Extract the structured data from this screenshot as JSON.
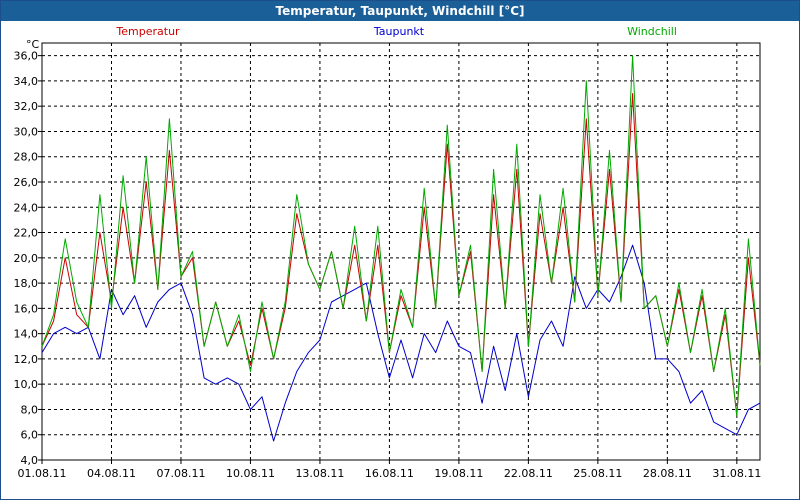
{
  "window": {
    "title": "Temperatur, Taupunkt, Windchill [°C]"
  },
  "chart_data": {
    "type": "line",
    "title": "Temperatur, Taupunkt, Windchill [°C]",
    "ylabel": "°C",
    "xlim": [
      1.0,
      32.0
    ],
    "ylim": [
      4.0,
      37.0
    ],
    "grid": true,
    "legend_position": "top",
    "x_tick_labels": [
      "01.08.11",
      "04.08.11",
      "07.08.11",
      "10.08.11",
      "13.08.11",
      "16.08.11",
      "19.08.11",
      "22.08.11",
      "25.08.11",
      "28.08.11",
      "31.08.11"
    ],
    "x_tick_values": [
      1,
      4,
      7,
      10,
      13,
      16,
      19,
      22,
      25,
      28,
      31
    ],
    "y_tick_labels": [
      "4,0",
      "6,0",
      "8,0",
      "10,0",
      "12,0",
      "14,0",
      "16,0",
      "18,0",
      "20,0",
      "22,0",
      "24,0",
      "26,0",
      "28,0",
      "30,0",
      "32,0",
      "34,0",
      "36,0"
    ],
    "y_tick_values": [
      4,
      6,
      8,
      10,
      12,
      14,
      16,
      18,
      20,
      22,
      24,
      26,
      28,
      30,
      32,
      34,
      36
    ],
    "x": [
      1.0,
      1.5,
      2.0,
      2.5,
      3.0,
      3.5,
      4.0,
      4.5,
      5.0,
      5.5,
      6.0,
      6.5,
      7.0,
      7.5,
      8.0,
      8.5,
      9.0,
      9.5,
      10.0,
      10.5,
      11.0,
      11.5,
      12.0,
      12.5,
      13.0,
      13.5,
      14.0,
      14.5,
      15.0,
      15.5,
      16.0,
      16.5,
      17.0,
      17.5,
      18.0,
      18.5,
      19.0,
      19.5,
      20.0,
      20.5,
      21.0,
      21.5,
      22.0,
      22.5,
      23.0,
      23.5,
      24.0,
      24.5,
      25.0,
      25.5,
      26.0,
      26.5,
      27.0,
      27.5,
      28.0,
      28.5,
      29.0,
      29.5,
      30.0,
      30.5,
      31.0,
      31.5,
      32.0
    ],
    "series": [
      {
        "name": "Temperatur",
        "color": "#cc0000",
        "values": [
          13.0,
          15.0,
          20.0,
          15.5,
          14.5,
          22.0,
          16.5,
          24.0,
          18.0,
          26.0,
          17.5,
          28.5,
          18.5,
          20.0,
          13.0,
          16.5,
          13.0,
          15.0,
          11.5,
          16.0,
          12.0,
          16.0,
          23.5,
          19.5,
          17.5,
          20.5,
          16.0,
          21.0,
          15.0,
          21.0,
          12.5,
          17.0,
          14.5,
          24.0,
          16.0,
          29.0,
          17.0,
          20.5,
          11.0,
          25.0,
          16.0,
          27.0,
          13.0,
          23.5,
          18.0,
          24.0,
          16.5,
          31.0,
          17.0,
          27.0,
          16.5,
          33.0,
          16.0,
          17.0,
          13.0,
          17.5,
          12.5,
          17.0,
          11.0,
          15.5,
          7.5,
          20.0,
          11.5
        ]
      },
      {
        "name": "Taupunkt",
        "color": "#0000cc",
        "values": [
          12.5,
          14.0,
          14.5,
          14.0,
          14.5,
          12.0,
          17.5,
          15.5,
          17.0,
          14.5,
          16.5,
          17.5,
          18.0,
          15.5,
          10.5,
          10.0,
          10.5,
          10.0,
          8.0,
          9.0,
          5.5,
          8.5,
          11.0,
          12.5,
          13.5,
          16.5,
          17.0,
          17.5,
          18.0,
          14.0,
          10.5,
          13.5,
          10.5,
          14.0,
          12.5,
          15.0,
          13.0,
          12.5,
          8.5,
          13.0,
          9.5,
          14.0,
          9.0,
          13.5,
          15.0,
          13.0,
          18.5,
          16.0,
          17.5,
          16.5,
          18.5,
          21.0,
          18.0,
          12.0,
          12.0,
          11.0,
          8.5,
          9.5,
          7.0,
          6.5,
          6.0,
          8.0,
          8.5
        ]
      },
      {
        "name": "Windchill",
        "color": "#00aa00",
        "values": [
          13.0,
          15.5,
          21.5,
          16.5,
          14.5,
          25.0,
          16.0,
          26.5,
          18.0,
          28.0,
          17.5,
          31.0,
          18.5,
          20.5,
          13.0,
          16.5,
          13.0,
          15.5,
          11.0,
          16.5,
          12.0,
          16.5,
          25.0,
          19.5,
          17.5,
          20.5,
          16.0,
          22.5,
          15.0,
          22.5,
          12.5,
          17.5,
          14.5,
          25.5,
          16.0,
          30.5,
          17.0,
          21.0,
          11.0,
          27.0,
          16.0,
          29.0,
          13.0,
          25.0,
          18.0,
          25.5,
          16.5,
          34.0,
          17.0,
          28.5,
          16.5,
          36.0,
          16.0,
          17.0,
          13.0,
          18.0,
          12.5,
          17.5,
          11.0,
          16.0,
          7.5,
          21.5,
          11.5
        ]
      }
    ]
  }
}
